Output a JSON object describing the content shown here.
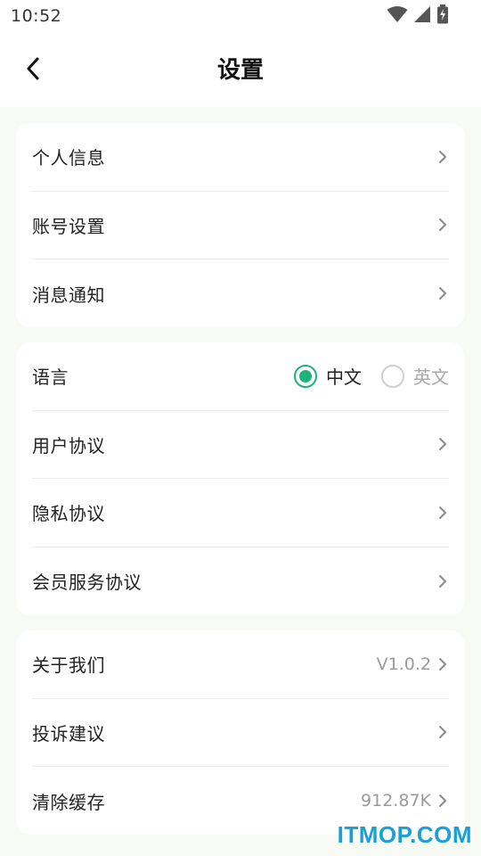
{
  "status_bar": {
    "time": "10:52",
    "icons": [
      "wifi-icon",
      "signal-icon",
      "battery-charging-icon"
    ]
  },
  "header": {
    "title": "设置",
    "back_icon": "chevron-left-icon"
  },
  "groups": [
    {
      "items": [
        {
          "label": "个人信息"
        },
        {
          "label": "账号设置"
        },
        {
          "label": "消息通知"
        }
      ]
    },
    {
      "language": {
        "label": "语言",
        "options": [
          {
            "label": "中文",
            "selected": true
          },
          {
            "label": "英文",
            "selected": false
          }
        ]
      },
      "items": [
        {
          "label": "用户协议"
        },
        {
          "label": "隐私协议"
        },
        {
          "label": "会员服务协议"
        }
      ]
    },
    {
      "items": [
        {
          "label": "关于我们",
          "value": "V1.0.2"
        },
        {
          "label": "投诉建议"
        },
        {
          "label": "清除缓存",
          "value": "912.87K"
        }
      ]
    }
  ],
  "watermark": "ITMOP.COM",
  "colors": {
    "accent": "#1fb27a",
    "background": "#f8faf6",
    "card": "#ffffff",
    "muted_text": "#9a9a9a",
    "watermark": "#1b9fd8"
  }
}
